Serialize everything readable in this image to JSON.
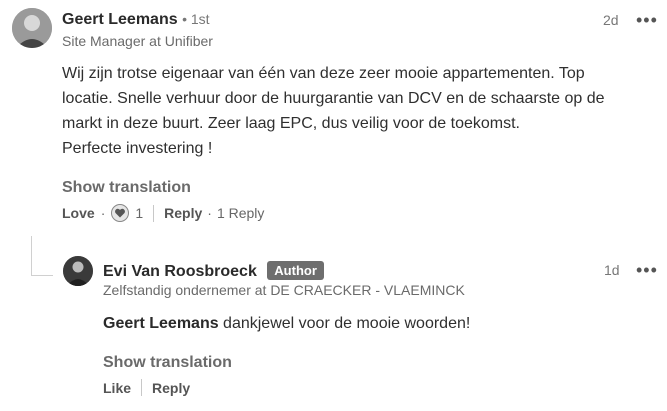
{
  "comment": {
    "author": "Geert Leemans",
    "degree": "• 1st",
    "headline": "Site Manager at Unifiber",
    "time": "2d",
    "more": "•••",
    "text_lines": [
      "Wij zijn trotse eigenaar van één van deze zeer mooie appartementen. Top",
      "locatie. Snelle verhuur door de huurgarantie van DCV en de schaarste op de",
      "markt in deze buurt. Zeer laag EPC, dus veilig voor de toekomst.",
      "Perfecte investering !"
    ],
    "show_translation": "Show translation",
    "love_label": "Love",
    "dot": "·",
    "reaction_count": "1",
    "reply_label": "Reply",
    "reply_count": "1 Reply"
  },
  "reply": {
    "author": "Evi Van Roosbroeck",
    "badge": "Author",
    "headline": "Zelfstandig ondernemer at DE CRAECKER - VLAEMINCK",
    "time": "1d",
    "more": "•••",
    "mention": "Geert Leemans",
    "text": " dankjewel voor de mooie woorden!",
    "show_translation": "Show translation",
    "like_label": "Like",
    "reply_label": "Reply"
  }
}
